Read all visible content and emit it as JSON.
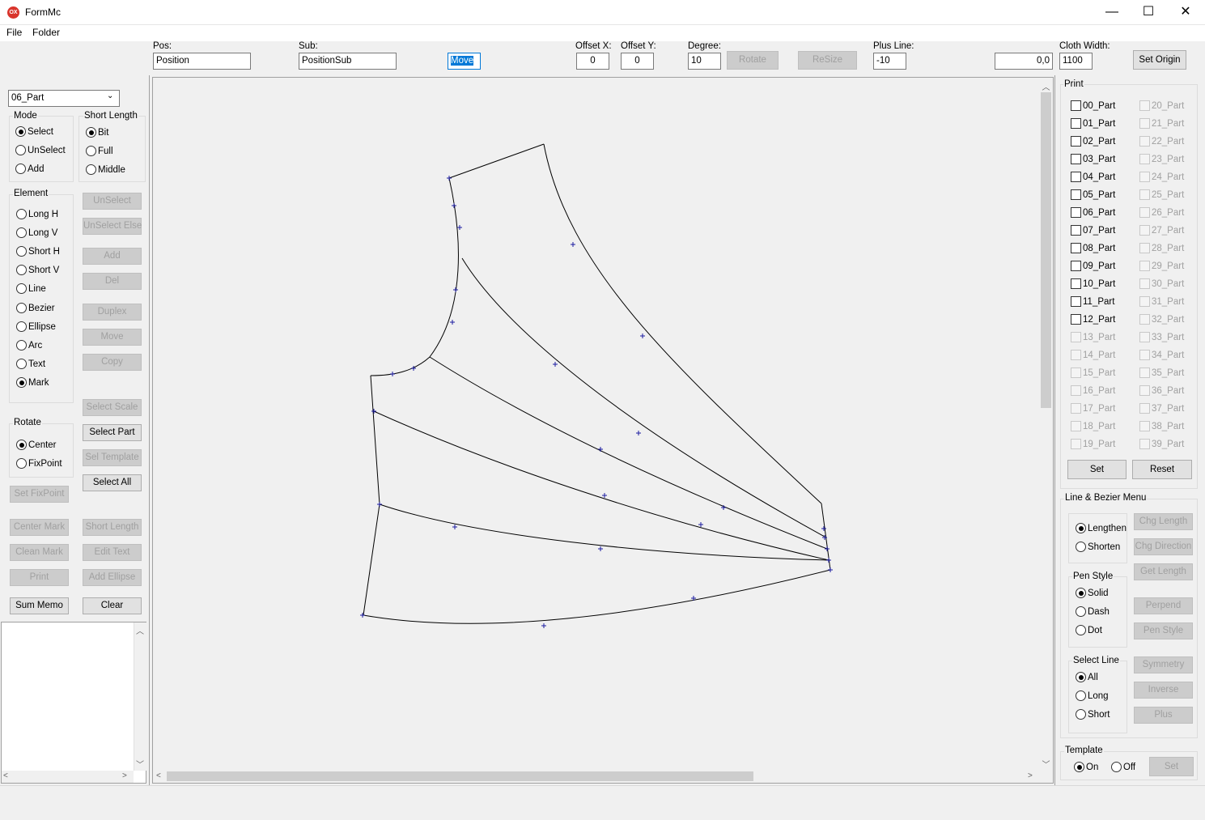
{
  "window": {
    "title": "FormMc",
    "icon_text": "OX",
    "minimize": "—",
    "maximize": "☐",
    "close": "✕"
  },
  "menu": {
    "file": "File",
    "folder": "Folder"
  },
  "toolbar": {
    "pos_label": "Pos:",
    "pos_value": "Position",
    "sub_label": "Sub:",
    "sub_value": "PositionSub",
    "mode_value": "Move",
    "offset_x_label": "Offset X:",
    "offset_x_value": "0",
    "offset_y_label": "Offset Y:",
    "offset_y_value": "0",
    "degree_label": "Degree:",
    "degree_value": "10",
    "rotate_button": "Rotate",
    "resize_button": "ReSize",
    "plus_line_label": "Plus Line:",
    "plus_line_value": "-10",
    "coord_value": "0,0",
    "cloth_width_label": "Cloth Width:",
    "cloth_width_value": "1100",
    "set_origin_button": "Set Origin"
  },
  "left": {
    "part_select": "06_Part",
    "mode_group": "Mode",
    "mode_select": "Select",
    "mode_unselect": "UnSelect",
    "mode_add": "Add",
    "short_length_group": "Short Length",
    "sl_bit": "Bit",
    "sl_full": "Full",
    "sl_middle": "Middle",
    "element_group": "Element",
    "el_long_h": "Long H",
    "el_long_v": "Long V",
    "el_short_h": "Short H",
    "el_short_v": "Short V",
    "el_line": "Line",
    "el_bezier": "Bezier",
    "el_ellipse": "Ellipse",
    "el_arc": "Arc",
    "el_text": "Text",
    "el_mark": "Mark",
    "btn_unselect": "UnSelect",
    "btn_unselect_else": "UnSelect Else",
    "btn_add": "Add",
    "btn_del": "Del",
    "btn_duplex": "Duplex",
    "btn_move": "Move",
    "btn_copy": "Copy",
    "btn_select_scale": "Select Scale",
    "btn_select_part": "Select Part",
    "btn_sel_template": "Sel Template",
    "btn_select_all": "Select All",
    "rotate_group": "Rotate",
    "rot_center": "Center",
    "rot_fixpoint": "FixPoint",
    "btn_set_fixpoint": "Set FixPoint",
    "btn_center_mark": "Center Mark",
    "btn_short_length": "Short Length",
    "btn_clean_mark": "Clean Mark",
    "btn_edit_text": "Edit Text",
    "btn_print": "Print",
    "btn_add_ellipse": "Add Ellipse",
    "btn_sum_memo": "Sum Memo",
    "btn_clear": "Clear"
  },
  "right": {
    "print_group": "Print",
    "parts_col1": [
      "00_Part",
      "01_Part",
      "02_Part",
      "03_Part",
      "04_Part",
      "05_Part",
      "06_Part",
      "07_Part",
      "08_Part",
      "09_Part",
      "10_Part",
      "11_Part",
      "12_Part",
      "13_Part",
      "14_Part",
      "15_Part",
      "16_Part",
      "17_Part",
      "18_Part",
      "19_Part"
    ],
    "parts_col2": [
      "20_Part",
      "21_Part",
      "22_Part",
      "23_Part",
      "24_Part",
      "25_Part",
      "26_Part",
      "27_Part",
      "28_Part",
      "29_Part",
      "30_Part",
      "31_Part",
      "32_Part",
      "33_Part",
      "34_Part",
      "35_Part",
      "36_Part",
      "37_Part",
      "38_Part",
      "39_Part"
    ],
    "set_button": "Set",
    "reset_button": "Reset",
    "line_bezier_group": "Line & Bezier Menu",
    "lengthen": "Lengthen",
    "shorten": "Shorten",
    "btn_chg_length": "Chg Length",
    "btn_chg_direction": "Chg Direction",
    "btn_get_length": "Get Length",
    "pen_style_group": "Pen Style",
    "pen_solid": "Solid",
    "pen_dash": "Dash",
    "pen_dot": "Dot",
    "btn_perpend": "Perpend",
    "btn_pen_style": "Pen Style",
    "select_line_group": "Select Line",
    "sel_all": "All",
    "sel_long": "Long",
    "sel_short": "Short",
    "btn_symmetry": "Symmetry",
    "btn_inverse": "Inverse",
    "btn_plus": "Plus",
    "template_group": "Template",
    "tpl_on": "On",
    "tpl_off": "Off",
    "tpl_set": "Set"
  }
}
